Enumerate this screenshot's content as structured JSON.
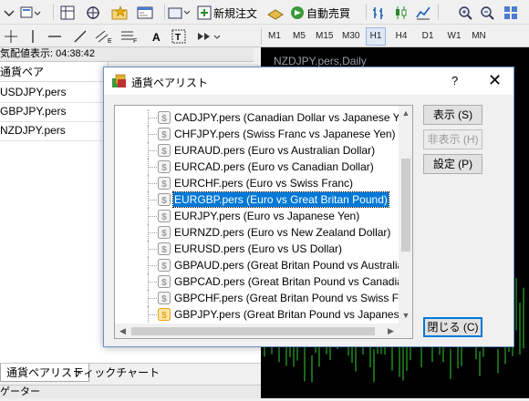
{
  "toolbar": {
    "new_order_label": "新規注文",
    "auto_trading_label": "自動売買"
  },
  "timeframes": [
    "M1",
    "M5",
    "M15",
    "M30",
    "H1",
    "H4",
    "D1",
    "W1",
    "MN"
  ],
  "active_timeframe": "H1",
  "market_watch": {
    "header": "気配値表示: 04:38:42",
    "column_header": "通貨ペア",
    "symbols": [
      "USDJPY.pers",
      "GBPJPY.pers",
      "NZDJPY.pers"
    ]
  },
  "bottom_tabs": [
    "通貨ペアリスト",
    "ティックチャート"
  ],
  "navigator_header": "ゲーター",
  "chart_title": "NZDJPY.pers,Daily",
  "dialog": {
    "title": "通貨ペアリスト",
    "help": "?",
    "close": "✕",
    "items": [
      {
        "label": "CADJPY.pers  (Canadian Dollar vs Japanese Yen)",
        "icon": "gray"
      },
      {
        "label": "CHFJPY.pers  (Swiss Franc vs Japanese Yen)",
        "icon": "gray"
      },
      {
        "label": "EURAUD.pers  (Euro vs Australian Dollar)",
        "icon": "gray"
      },
      {
        "label": "EURCAD.pers  (Euro vs Canadian Dollar)",
        "icon": "gray"
      },
      {
        "label": "EURCHF.pers  (Euro vs Swiss Franc)",
        "icon": "gray"
      },
      {
        "label": "EURGBP.pers  (Euro vs Great Britan Pound)",
        "icon": "gray",
        "selected": true
      },
      {
        "label": "EURJPY.pers  (Euro vs Japanese Yen)",
        "icon": "gray"
      },
      {
        "label": "EURNZD.pers  (Euro vs New Zealand Dollar)",
        "icon": "gray"
      },
      {
        "label": "EURUSD.pers  (Euro vs US Dollar)",
        "icon": "gray"
      },
      {
        "label": "GBPAUD.pers  (Great Britan Pound vs Australian Do",
        "icon": "gray"
      },
      {
        "label": "GBPCAD.pers  (Great Britan Pound vs Canadian Do",
        "icon": "gray"
      },
      {
        "label": "GBPCHF.pers  (Great Britan Pound vs Swiss Franc)",
        "icon": "gray"
      },
      {
        "label": "GBPJPY.pers  (Great Britan Pound vs Japanese Ye",
        "icon": "gold"
      }
    ],
    "buttons": {
      "show": "表示 (S)",
      "hide": "非表示 (H)",
      "settings": "設定 (P)",
      "close": "閉じる (C)"
    },
    "colors": {
      "selection": "#0078d7",
      "icon_gray": "#9a9a9a",
      "icon_gold": "#e6a817"
    }
  }
}
